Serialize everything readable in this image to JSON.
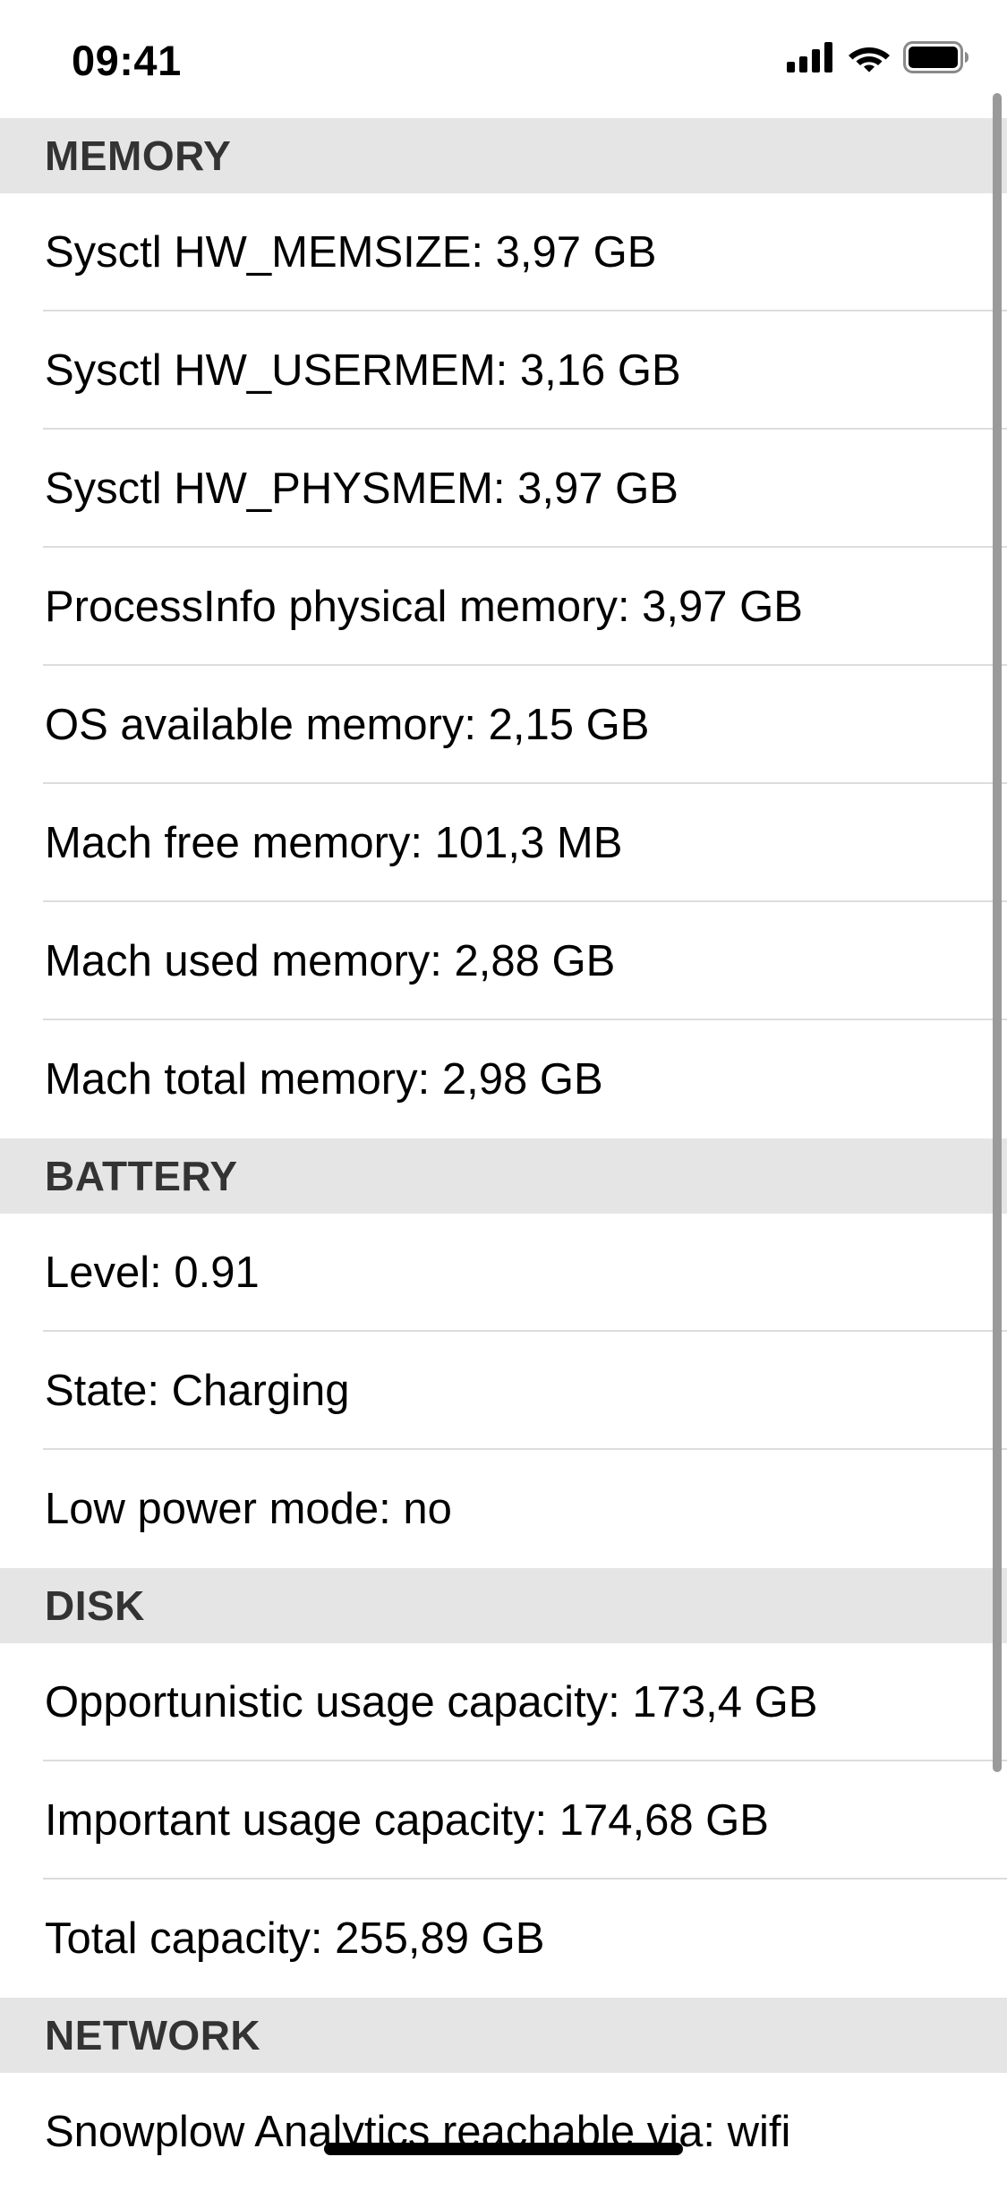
{
  "status_bar": {
    "time": "09:41",
    "icons": [
      "cellular-signal-icon",
      "wifi-icon",
      "battery-icon"
    ]
  },
  "sections": {
    "memory": {
      "title": "MEMORY",
      "rows": [
        "Sysctl HW_MEMSIZE: 3,97 GB",
        "Sysctl HW_USERMEM: 3,16 GB",
        "Sysctl HW_PHYSMEM: 3,97 GB",
        "ProcessInfo physical memory: 3,97 GB",
        "OS available memory: 2,15 GB",
        "Mach free memory: 101,3 MB",
        "Mach used memory: 2,88 GB",
        "Mach total memory: 2,98 GB"
      ]
    },
    "battery": {
      "title": "BATTERY",
      "rows": [
        "Level: 0.91",
        "State: Charging",
        "Low power mode: no"
      ]
    },
    "disk": {
      "title": "DISK",
      "rows": [
        "Opportunistic usage capacity: 173,4 GB",
        "Important usage capacity: 174,68 GB",
        "Total capacity: 255,89 GB"
      ]
    },
    "network": {
      "title": "NETWORK",
      "rows": [
        "Snowplow Analytics reachable via: wifi"
      ]
    }
  }
}
